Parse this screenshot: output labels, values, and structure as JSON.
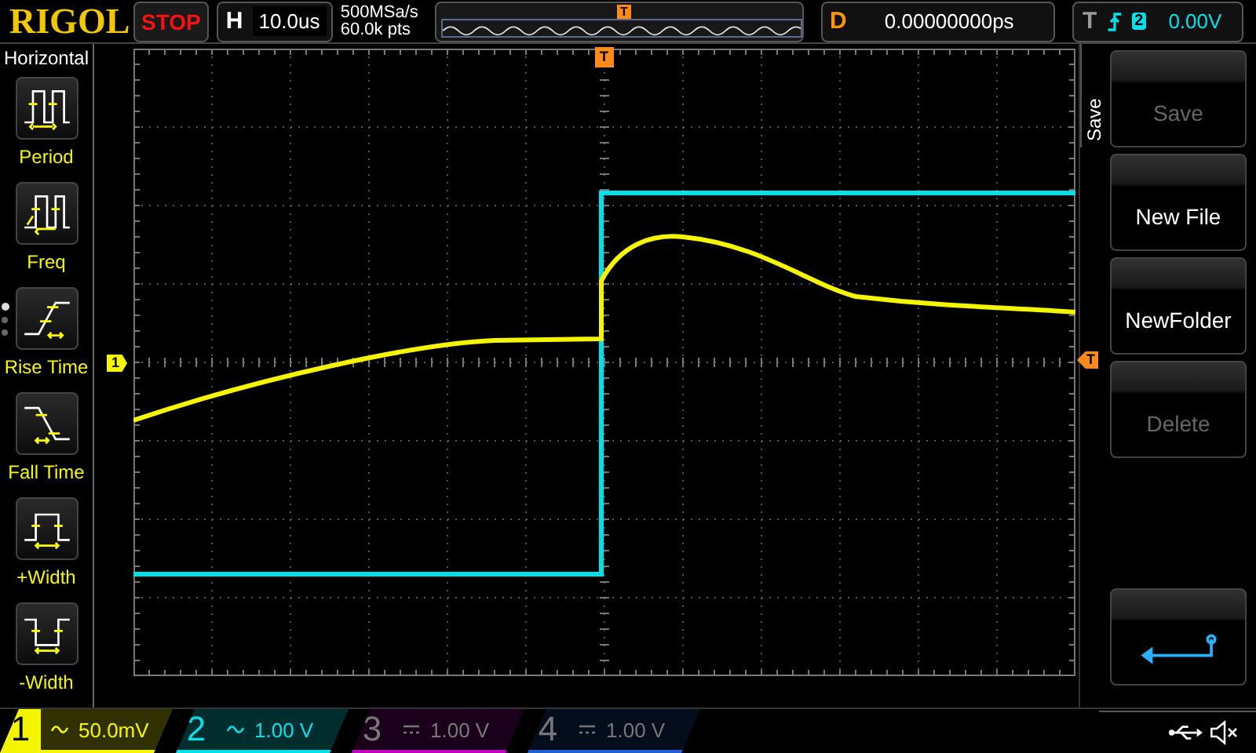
{
  "top_bar": {
    "logo": "RIGOL",
    "run_state": "STOP",
    "timebase_label": "H",
    "timebase": "10.0us",
    "sample_rate": "500MSa/s",
    "memory_depth": "60.0k pts",
    "trigger_position_marker": "T",
    "delay_label": "D",
    "delay": "0.00000000ps",
    "trigger_label": "T",
    "trigger_source": "2",
    "trigger_level": "0.00V"
  },
  "sidebar": {
    "title": "Horizontal",
    "items": [
      {
        "label": "Period",
        "kind": "period"
      },
      {
        "label": "Freq",
        "kind": "freq"
      },
      {
        "label": "Rise Time",
        "kind": "rise"
      },
      {
        "label": "Fall Time",
        "kind": "fall"
      },
      {
        "label": "+Width",
        "kind": "pwidth"
      },
      {
        "label": "-Width",
        "kind": "nwidth"
      }
    ],
    "pages": [
      {
        "selected": true
      },
      {
        "selected": false
      },
      {
        "selected": false
      }
    ]
  },
  "screen": {
    "channel_marker": "1",
    "trigger_marker_top": "T",
    "trigger_marker_right": "T"
  },
  "menu": {
    "title": "Save",
    "buttons": [
      {
        "label": "Save",
        "disabled": true
      },
      {
        "label": "New File",
        "disabled": false
      },
      {
        "label": "NewFolder",
        "disabled": false
      },
      {
        "label": "Delete",
        "disabled": true
      }
    ]
  },
  "channels": [
    {
      "number": "1",
      "kind": "ac",
      "scale": "50.0mV",
      "on": true,
      "color": "#f5f500"
    },
    {
      "number": "2",
      "kind": "ac",
      "scale": "1.00 V",
      "on": true,
      "color": "#00e0e8"
    },
    {
      "number": "3",
      "kind": "dc",
      "scale": "1.00 V",
      "on": false,
      "color": "#c000c0"
    },
    {
      "number": "4",
      "kind": "dc",
      "scale": "1.00 V",
      "on": false,
      "color": "#2060d0"
    }
  ]
}
